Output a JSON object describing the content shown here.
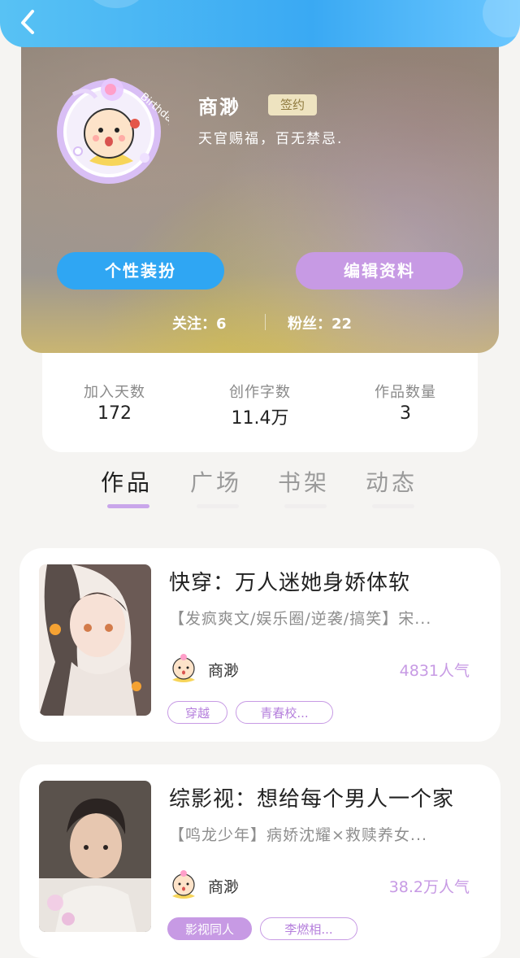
{
  "header": {
    "back_icon": "chevron-left-icon",
    "accent": "#3aa9f3"
  },
  "profile": {
    "name": "商渺",
    "badge": "签约",
    "motto": "天官赐福，百无禁忌.",
    "avatar_frame_text": "Birthday",
    "dress_button": "个性装扮",
    "edit_button": "编辑资料",
    "following": "关注：6",
    "followers": "粉丝：22"
  },
  "stats": [
    {
      "label": "加入天数",
      "value": "172"
    },
    {
      "label": "创作字数",
      "value": "11.4万"
    },
    {
      "label": "作品数量",
      "value": "3"
    }
  ],
  "tabs": [
    {
      "label": "作品",
      "active": true
    },
    {
      "label": "广场",
      "active": false
    },
    {
      "label": "书架",
      "active": false
    },
    {
      "label": "动态",
      "active": false
    }
  ],
  "works": [
    {
      "title": "快穿：万人迷她身娇体软",
      "desc": "【发疯爽文/娱乐圈/逆袭/搞笑】宋...",
      "author": "商渺",
      "popularity": "4831人气",
      "tags": [
        "穿越",
        "青春校..."
      ]
    },
    {
      "title": "综影视：想给每个男人一个家",
      "desc": "【鸣龙少年】病娇沈耀×救赎养女...",
      "author": "商渺",
      "popularity": "38.2万人气",
      "tags": [
        "影视同人",
        "李燃相..."
      ]
    }
  ],
  "colors": {
    "accent_blue": "#2fa6f3",
    "accent_purple": "#c79ae4",
    "badge_bg": "#eee3c0"
  }
}
